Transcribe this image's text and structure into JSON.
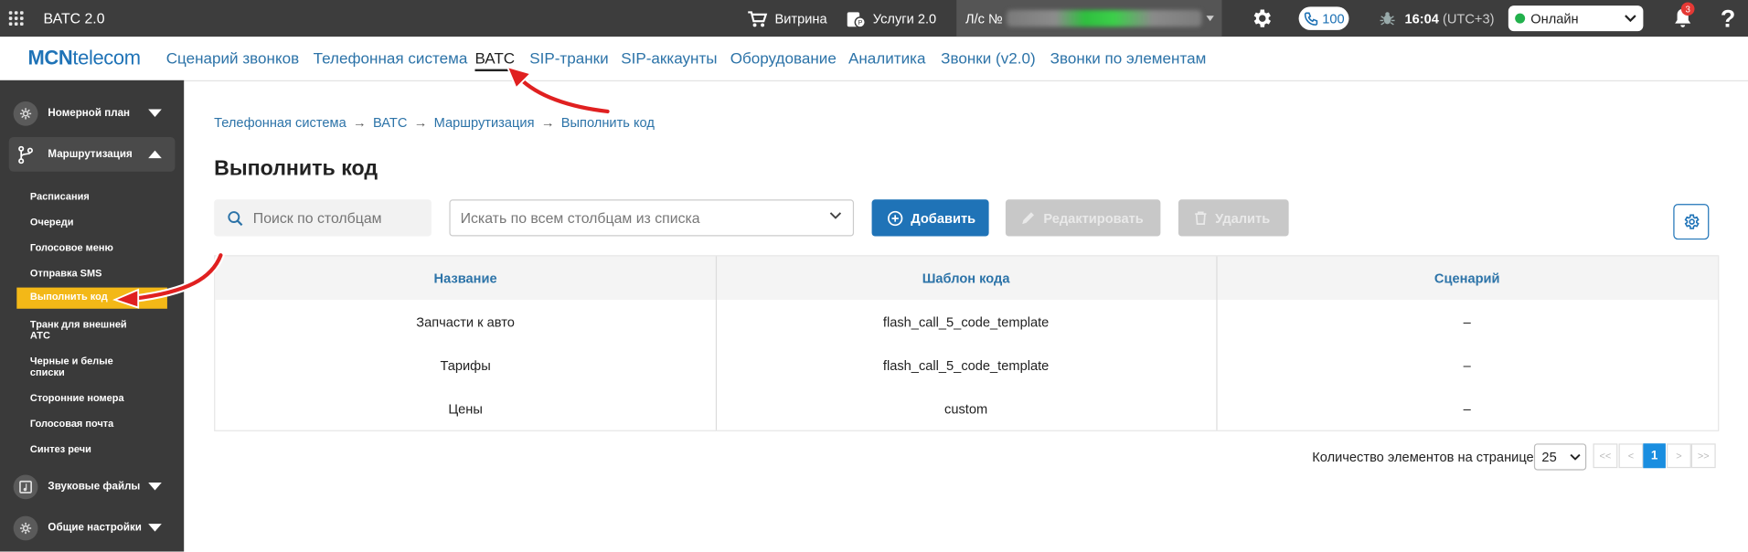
{
  "topbar": {
    "app_title": "ВАТС 2.0",
    "showcase": "Витрина",
    "services": "Услуги 2.0",
    "account_prefix": "Л/с №",
    "phone_count": "100",
    "time": "16:04",
    "timezone": "(UTC+3)",
    "status": "Онлайн",
    "notifications": "3"
  },
  "brand": {
    "logo_bold": "MCN",
    "logo_rest": "telecom"
  },
  "menu": [
    "Сценарий звонков",
    "Телефонная система",
    "ВАТС",
    "SIP-транки",
    "SIP-аккаунты",
    "Оборудование",
    "Аналитика",
    "Звонки (v2.0)",
    "Звонки по элементам"
  ],
  "sidebar": {
    "groups": [
      "Номерной план",
      "Маршрутизация",
      "Звуковые файлы",
      "Общие настройки"
    ],
    "items": [
      "Расписания",
      "Очереди",
      "Голосовое меню",
      "Отправка SMS",
      "Выполнить код",
      "Транк для внешней АТС",
      "Черные и белые списки",
      "Сторонние номера",
      "Голосовая почта",
      "Синтез речи"
    ]
  },
  "breadcrumbs": [
    "Телефонная система",
    "ВАТС",
    "Маршрутизация",
    "Выполнить код"
  ],
  "page": {
    "title": "Выполнить код",
    "search_placeholder": "Поиск по столбцам",
    "column_search": "Искать по всем столбцам из списка",
    "add": "Добавить",
    "edit": "Редактировать",
    "delete": "Удалить"
  },
  "table": {
    "headers": [
      "Название",
      "Шаблон кода",
      "Сценарий"
    ],
    "rows": [
      [
        "Запчасти к авто",
        "flash_call_5_code_template",
        "–"
      ],
      [
        "Тарифы",
        "flash_call_5_code_template",
        "–"
      ],
      [
        "Цены",
        "custom",
        "–"
      ]
    ]
  },
  "pager": {
    "label": "Количество элементов на странице",
    "page_size": "25",
    "first": "<<",
    "prev": "<",
    "current": "1",
    "next": ">",
    "last": ">>"
  },
  "colors": {
    "accent": "#1f73b7",
    "active_item": "#f3b817",
    "topbar": "#3d3d3d",
    "sidebar": "#3a3a3a",
    "annotation": "#e02020"
  },
  "icons": [
    "apps-grid-icon",
    "cart-icon",
    "services-icon",
    "gear-icon",
    "phone-icon",
    "bug-icon",
    "bell-icon",
    "help-icon",
    "search-icon",
    "plus-circle-icon",
    "pencil-icon",
    "trash-icon",
    "dial-plan-icon",
    "routing-icon",
    "sound-files-icon",
    "settings-icon"
  ]
}
